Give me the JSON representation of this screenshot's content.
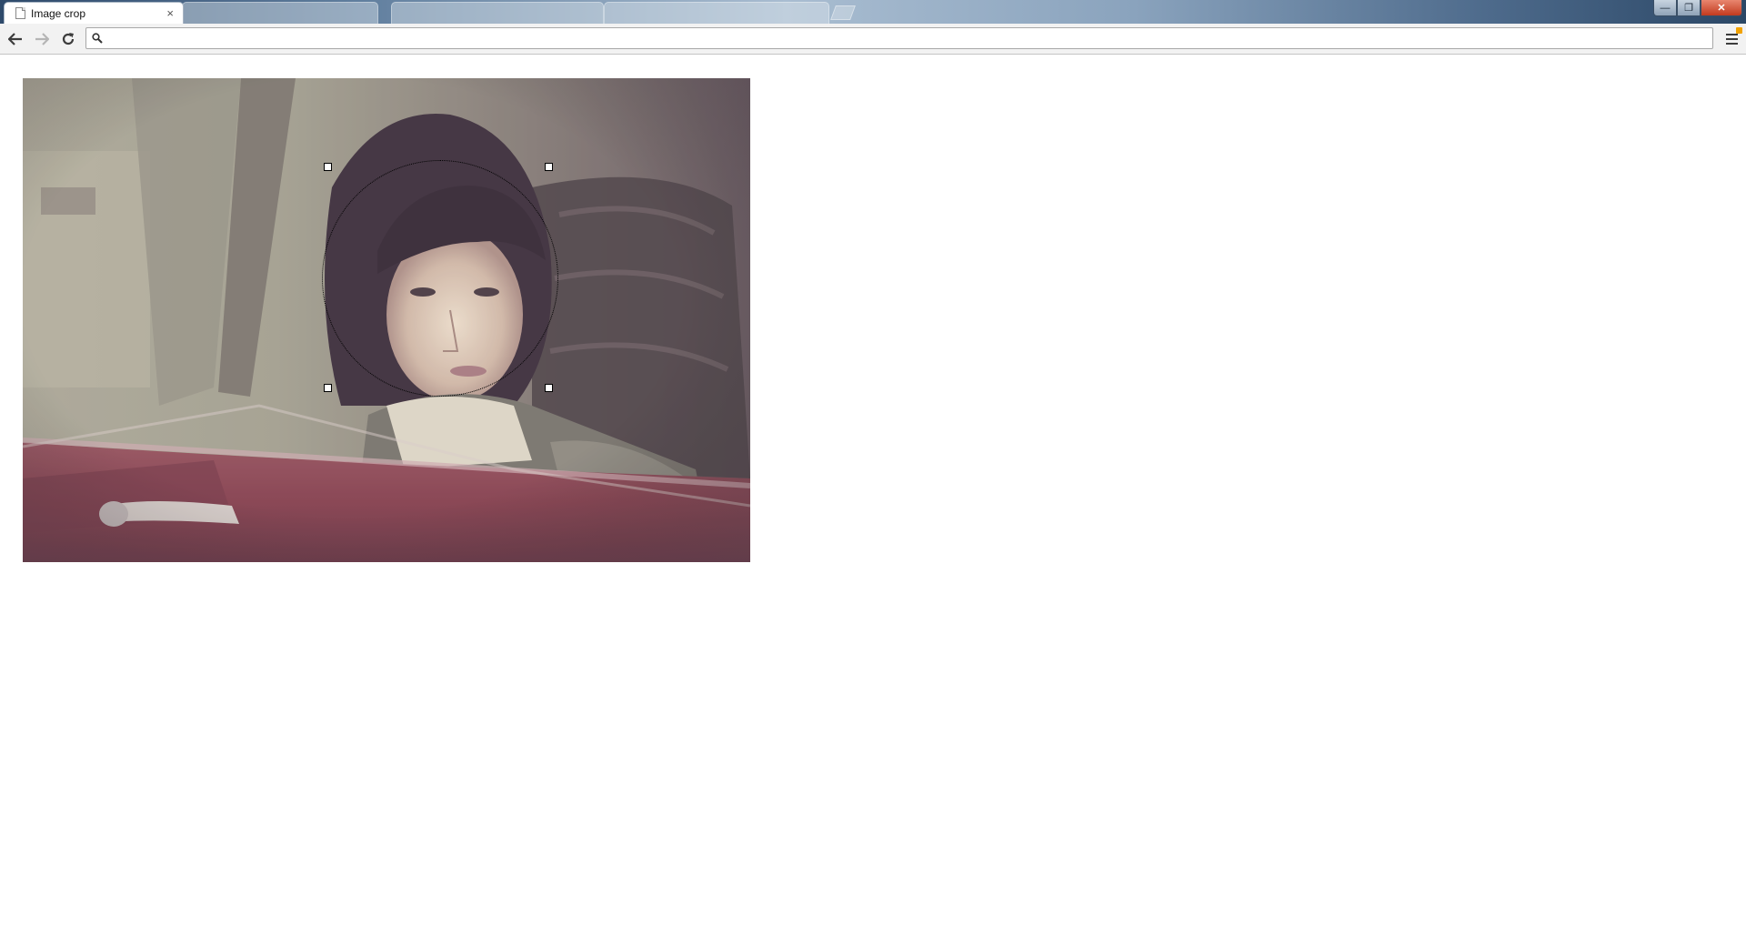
{
  "browser": {
    "active_tab": {
      "title": "Image crop",
      "close_glyph": "×"
    },
    "background_tabs": [
      {
        "title": ""
      },
      {
        "title": ""
      },
      {
        "title": ""
      }
    ],
    "window_controls": {
      "minimize": "—",
      "maximize": "❐",
      "close": "✕"
    },
    "toolbar": {
      "back_glyph": "←",
      "forward_glyph": "→",
      "reload_glyph": "↻",
      "address_value": "",
      "address_placeholder": ""
    },
    "colors": {
      "menu_badge": "#f2a200",
      "close_button": "#c23a1f"
    }
  },
  "page": {
    "image": {
      "description_icon": "photo-woman-in-car",
      "dominant_colors": [
        "#a39c8a",
        "#6b4a5a",
        "#7a3040",
        "#f1e4cf"
      ]
    },
    "crop_selection": {
      "shape": "circle",
      "outline": "dotted",
      "handles": [
        "top-left",
        "top-right",
        "bottom-left",
        "bottom-right"
      ]
    }
  }
}
